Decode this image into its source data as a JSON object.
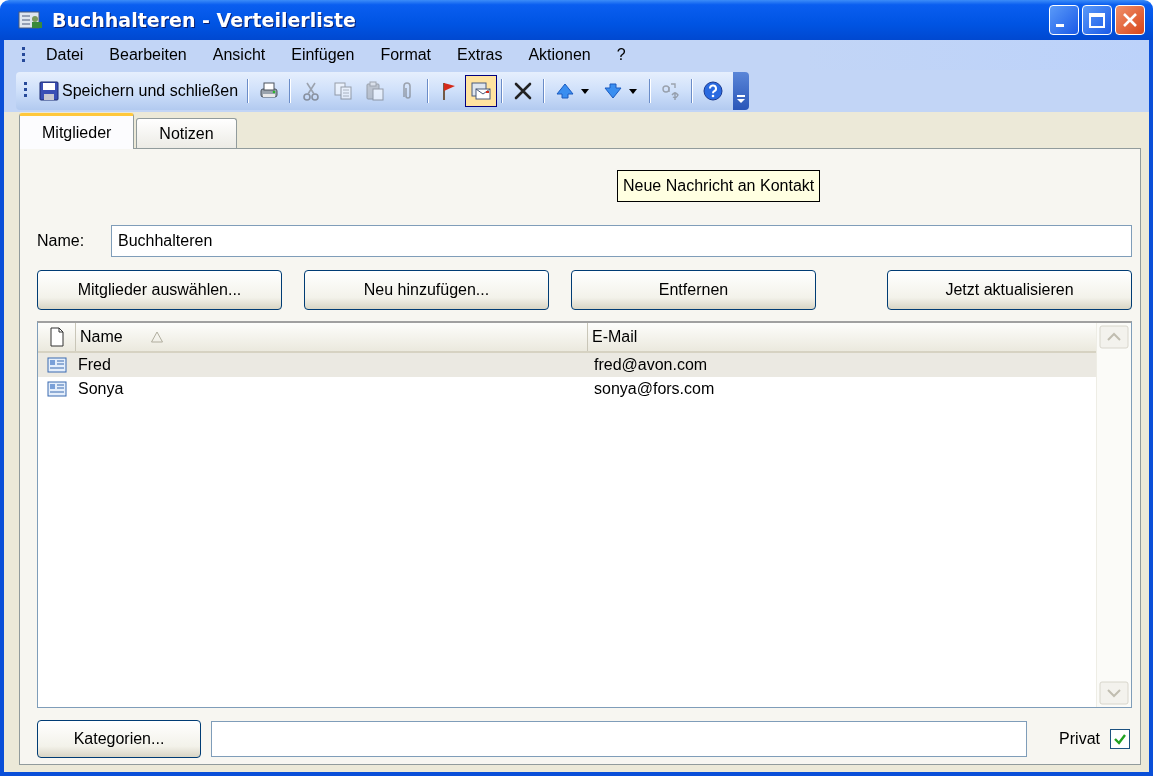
{
  "window": {
    "title": "Buchhalteren - Verteilerliste"
  },
  "menu": [
    {
      "label": "Datei"
    },
    {
      "label": "Bearbeiten"
    },
    {
      "label": "Ansicht"
    },
    {
      "label": "Einfügen"
    },
    {
      "label": "Format"
    },
    {
      "label": "Extras"
    },
    {
      "label": "Aktionen"
    },
    {
      "label": "?"
    }
  ],
  "toolbar": {
    "save_label": "Speichern und schließen",
    "buttons": [
      {
        "disabled": false,
        "selected": false
      },
      {
        "disabled": true,
        "selected": false
      },
      {
        "disabled": true,
        "selected": false
      },
      {
        "disabled": true,
        "selected": false
      },
      {
        "disabled": true,
        "selected": false
      },
      {
        "disabled": false,
        "selected": false
      },
      {
        "disabled": false,
        "selected": true
      },
      {
        "disabled": false,
        "selected": false
      },
      {
        "disabled": false,
        "selected": false
      },
      {
        "disabled": false,
        "selected": false
      },
      {
        "disabled": true,
        "selected": false
      },
      {
        "disabled": false,
        "selected": false
      }
    ]
  },
  "tooltip": {
    "text": "Neue Nachricht an Kontakt"
  },
  "tabs": [
    {
      "label": "Mitglieder",
      "selected": true
    },
    {
      "label": "Notizen",
      "selected": false
    }
  ],
  "name_field": {
    "label": "Name:",
    "value": "Buchhalteren"
  },
  "action_buttons": [
    {
      "label": "Mitglieder auswählen..."
    },
    {
      "label": "Neu hinzufügen..."
    },
    {
      "label": "Entfernen"
    },
    {
      "label": "Jetzt aktualisieren"
    }
  ],
  "members": {
    "columns": [
      {
        "label": "Name",
        "sorted": true
      },
      {
        "label": "E-Mail",
        "sorted": false
      }
    ],
    "rows": [
      {
        "name": "Fred",
        "email": "fred@avon.com",
        "selected": true
      },
      {
        "name": "Sonya",
        "email": "sonya@fors.com",
        "selected": false
      }
    ]
  },
  "categories": {
    "button": "Kategorien..."
  },
  "private": {
    "label": "Privat",
    "checked": true
  }
}
